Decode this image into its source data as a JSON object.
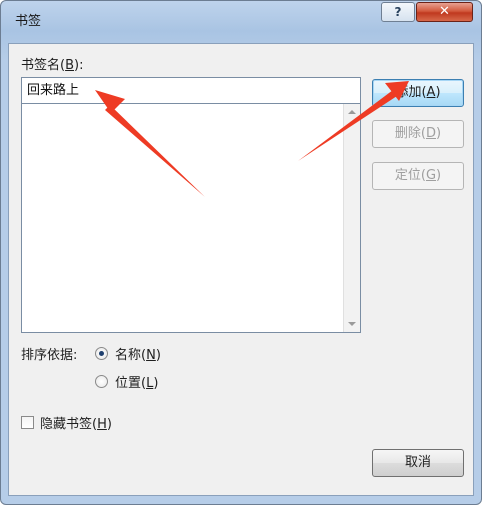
{
  "dialog": {
    "title": "书签",
    "help_glyph": "?",
    "close_glyph": "✕"
  },
  "bookmark_name": {
    "label_prefix": "书签名(",
    "label_key": "B",
    "label_suffix": "):",
    "value": "回来路上"
  },
  "buttons": {
    "add": {
      "prefix": "添加(",
      "key": "A",
      "suffix": ")"
    },
    "delete": {
      "prefix": "删除(",
      "key": "D",
      "suffix": ")"
    },
    "goto": {
      "prefix": "定位(",
      "key": "G",
      "suffix": ")"
    },
    "cancel": "取消"
  },
  "sort": {
    "label": "排序依据:",
    "options": [
      {
        "prefix": "名称(",
        "key": "N",
        "suffix": ")",
        "checked": true
      },
      {
        "prefix": "位置(",
        "key": "L",
        "suffix": ")",
        "checked": false
      }
    ]
  },
  "hidden_bookmarks": {
    "prefix": "隐藏书签(",
    "key": "H",
    "suffix": ")",
    "checked": false
  },
  "colors": {
    "annotation_arrow": "#ee3b24",
    "default_button_border": "#3c7fb1",
    "close_button": "#c0391f"
  }
}
